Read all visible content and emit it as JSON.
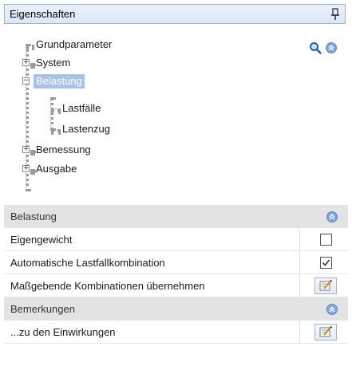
{
  "panel": {
    "title": "Eigenschaften",
    "pin_icon": "pin-icon"
  },
  "tree": {
    "items": [
      {
        "label": "Grundparameter",
        "expander": null
      },
      {
        "label": "System",
        "expander": "+"
      },
      {
        "label": "Belastung",
        "expander": "−",
        "selected": true
      },
      {
        "label": "Lastfälle",
        "expander": null
      },
      {
        "label": "Lastenzug",
        "expander": null
      },
      {
        "label": "Bemessung",
        "expander": "+"
      },
      {
        "label": "Ausgabe",
        "expander": "+"
      }
    ],
    "tools": {
      "search_icon": "search-icon",
      "collapse_icon": "collapse-up-icon"
    }
  },
  "grid": {
    "sections": [
      {
        "label": "Belastung",
        "rows": [
          {
            "label": "Eigengewicht",
            "type": "checkbox",
            "checked": false
          },
          {
            "label": "Automatische Lastfallkombination",
            "type": "checkbox",
            "checked": true
          },
          {
            "label": "Maßgebende Kombinationen übernehmen",
            "type": "edit-button"
          }
        ]
      },
      {
        "label": "Bemerkungen",
        "rows": [
          {
            "label": "...zu den Einwirkungen",
            "type": "edit-button"
          }
        ]
      }
    ]
  },
  "colors": {
    "selection": "#a9c2e6",
    "header_border": "#99b4d1",
    "section_bg": "#e3e3e3",
    "accent": "#7fa6d8"
  }
}
